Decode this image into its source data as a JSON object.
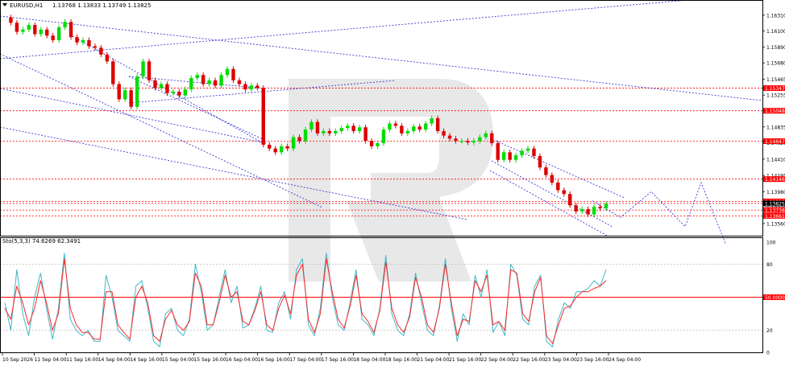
{
  "header": {
    "symbol_label": "EURUSD,H1",
    "ohlc_text": "1.13768 1.13833 1.13749 1.13825"
  },
  "indicator": {
    "label": "Sto(5,3,3) 74.6269 62.3491",
    "level_label": "50.0000"
  },
  "colors": {
    "bull": "#00dd00",
    "bear": "#dd0000",
    "trendline": "#3b3bd6",
    "level_line": "#ff0000",
    "sto_main": "#40b8c8",
    "sto_signal": "#ff2a2a",
    "watermark": "#e6e6e6"
  },
  "chart_data": [
    {
      "type": "candlestick",
      "ylim": [
        1.1341,
        1.1651
      ],
      "y_ticks": [
        "1.16520",
        "1.16310",
        "1.16100",
        "1.15890",
        "1.15680",
        "1.15465",
        "1.15255",
        "1.15045",
        "1.14835",
        "1.14625",
        "1.14410",
        "1.14195",
        "1.13980",
        "1.13770",
        "1.13560"
      ],
      "price_tags": [
        {
          "label": "1.15347",
          "value": 1.15347
        },
        {
          "label": "1.15048",
          "value": 1.15048
        },
        {
          "label": "1.14647",
          "value": 1.14647
        },
        {
          "label": "1.14146",
          "value": 1.14146
        },
        {
          "label": "1.13852",
          "value": 1.13852
        },
        {
          "label": "1.13825",
          "value": 1.13825
        },
        {
          "label": "1.13738",
          "value": 1.13738
        },
        {
          "label": "1.13661",
          "value": 1.13661
        }
      ],
      "x_tick_labels": [
        "10 Sep 2026",
        "11 Sep 04:00",
        "11 Sep 16:00",
        "14 Sep 04:00",
        "14 Sep 16:00",
        "15 Sep 04:00",
        "15 Sep 16:00",
        "16 Sep 04:00",
        "16 Sep 16:00",
        "17 Sep 04:00",
        "17 Sep 16:00",
        "18 Sep 04:00",
        "18 Sep 16:00",
        "21 Sep 04:00",
        "21 Sep 16:00",
        "22 Sep 04:00",
        "22 Sep 16:00",
        "23 Sep 04:00",
        "23 Sep 16:00",
        "24 Sep 04:00"
      ],
      "price_path": [
        1.1628,
        1.1621,
        1.1609,
        1.1612,
        1.1618,
        1.1606,
        1.1612,
        1.1604,
        1.1598,
        1.1615,
        1.1622,
        1.1602,
        1.1595,
        1.1598,
        1.159,
        1.1588,
        1.1579,
        1.157,
        1.154,
        1.152,
        1.1532,
        1.151,
        1.155,
        1.157,
        1.1545,
        1.1535,
        1.154,
        1.1528,
        1.153,
        1.1525,
        1.1533,
        1.1548,
        1.1552,
        1.154,
        1.1545,
        1.1538,
        1.1552,
        1.156,
        1.1545,
        1.154,
        1.1533,
        1.1538,
        1.1535,
        1.146,
        1.1455,
        1.145,
        1.1458,
        1.1455,
        1.147,
        1.1465,
        1.148,
        1.149,
        1.1475,
        1.1478,
        1.1475,
        1.1478,
        1.1482,
        1.1485,
        1.1478,
        1.1483,
        1.1465,
        1.1458,
        1.1462,
        1.148,
        1.1488,
        1.1485,
        1.1475,
        1.1478,
        1.1484,
        1.148,
        1.1488,
        1.1495,
        1.1478,
        1.1472,
        1.1468,
        1.1465,
        1.1465,
        1.1463,
        1.1465,
        1.147,
        1.1475,
        1.1462,
        1.144,
        1.145,
        1.144,
        1.1446,
        1.1452,
        1.1455,
        1.1445,
        1.143,
        1.142,
        1.141,
        1.14,
        1.1395,
        1.138,
        1.1372,
        1.1375,
        1.1368,
        1.1378,
        1.1376,
        1.1382
      ],
      "forecast_path": [
        1.1386,
        1.1364,
        1.1398,
        1.1352,
        1.141,
        1.133
      ]
    },
    {
      "type": "line",
      "name": "Stochastic",
      "ylim": [
        0,
        100
      ],
      "y_ticks": [
        "100",
        "80",
        "50.0000",
        "20",
        "0"
      ],
      "main_path": [
        45,
        20,
        75,
        35,
        15,
        50,
        72,
        40,
        12,
        40,
        90,
        30,
        20,
        15,
        20,
        10,
        10,
        70,
        50,
        20,
        15,
        10,
        60,
        65,
        40,
        10,
        5,
        35,
        40,
        20,
        15,
        30,
        80,
        55,
        20,
        25,
        50,
        75,
        45,
        60,
        22,
        25,
        40,
        60,
        20,
        18,
        45,
        55,
        30,
        75,
        85,
        25,
        15,
        40,
        90,
        50,
        25,
        20,
        45,
        75,
        30,
        25,
        15,
        40,
        88,
        35,
        20,
        15,
        35,
        72,
        45,
        20,
        15,
        42,
        85,
        40,
        10,
        35,
        25,
        70,
        50,
        75,
        18,
        28,
        15,
        80,
        70,
        30,
        25,
        60,
        70,
        10,
        5,
        30,
        45,
        40,
        55,
        55,
        58,
        65,
        60,
        75
      ],
      "signal_path": [
        40,
        30,
        60,
        45,
        25,
        40,
        65,
        45,
        20,
        35,
        85,
        40,
        25,
        18,
        18,
        12,
        12,
        55,
        55,
        25,
        18,
        12,
        50,
        60,
        45,
        15,
        10,
        30,
        38,
        25,
        20,
        28,
        72,
        60,
        25,
        25,
        45,
        70,
        50,
        55,
        28,
        25,
        38,
        55,
        25,
        20,
        40,
        52,
        35,
        70,
        80,
        30,
        18,
        35,
        85,
        55,
        30,
        22,
        42,
        70,
        35,
        28,
        18,
        38,
        82,
        40,
        25,
        18,
        32,
        68,
        50,
        25,
        18,
        40,
        80,
        45,
        15,
        30,
        28,
        65,
        55,
        70,
        25,
        28,
        20,
        75,
        72,
        35,
        28,
        55,
        68,
        15,
        8,
        25,
        40,
        42,
        50,
        55,
        55,
        58,
        60,
        65
      ]
    }
  ]
}
